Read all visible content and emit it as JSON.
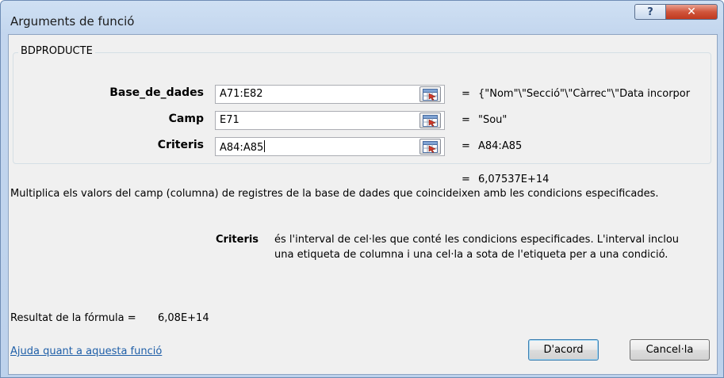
{
  "dialog": {
    "title": "Arguments de funció",
    "help_button": "?",
    "close_button": "✕"
  },
  "function_group": {
    "name": "BDPRODUCTE",
    "arguments": [
      {
        "label": "Base_de_dades",
        "value": "A71:E82",
        "result": "{\"Nom\"\\\"Secció\"\\\"Càrrec\"\\\"Data incorpor"
      },
      {
        "label": "Camp",
        "value": "E71",
        "result": "\"Sou\""
      },
      {
        "label": "Criteris",
        "value": "A84:A85",
        "result": "A84:A85"
      }
    ]
  },
  "equals_sign": "=",
  "function_result": "6,07537E+14",
  "description": "Multiplica els valors del camp (columna) de registres de la base de dades que coincideixen amb les condicions especificades.",
  "argument_help": {
    "name": "Criteris",
    "text_line1": "és l'interval de cel·les que conté les condicions especificades. L'interval inclou",
    "text_line2": "una etiqueta de columna i una cel·la a sota de l'etiqueta per a una condició."
  },
  "formula_result": {
    "label": "Resultat de la fórmula =",
    "value": "6,08E+14"
  },
  "help_link": "Ajuda quant a aquesta funció",
  "buttons": {
    "ok": "D'acord",
    "cancel": "Cancel·la"
  }
}
